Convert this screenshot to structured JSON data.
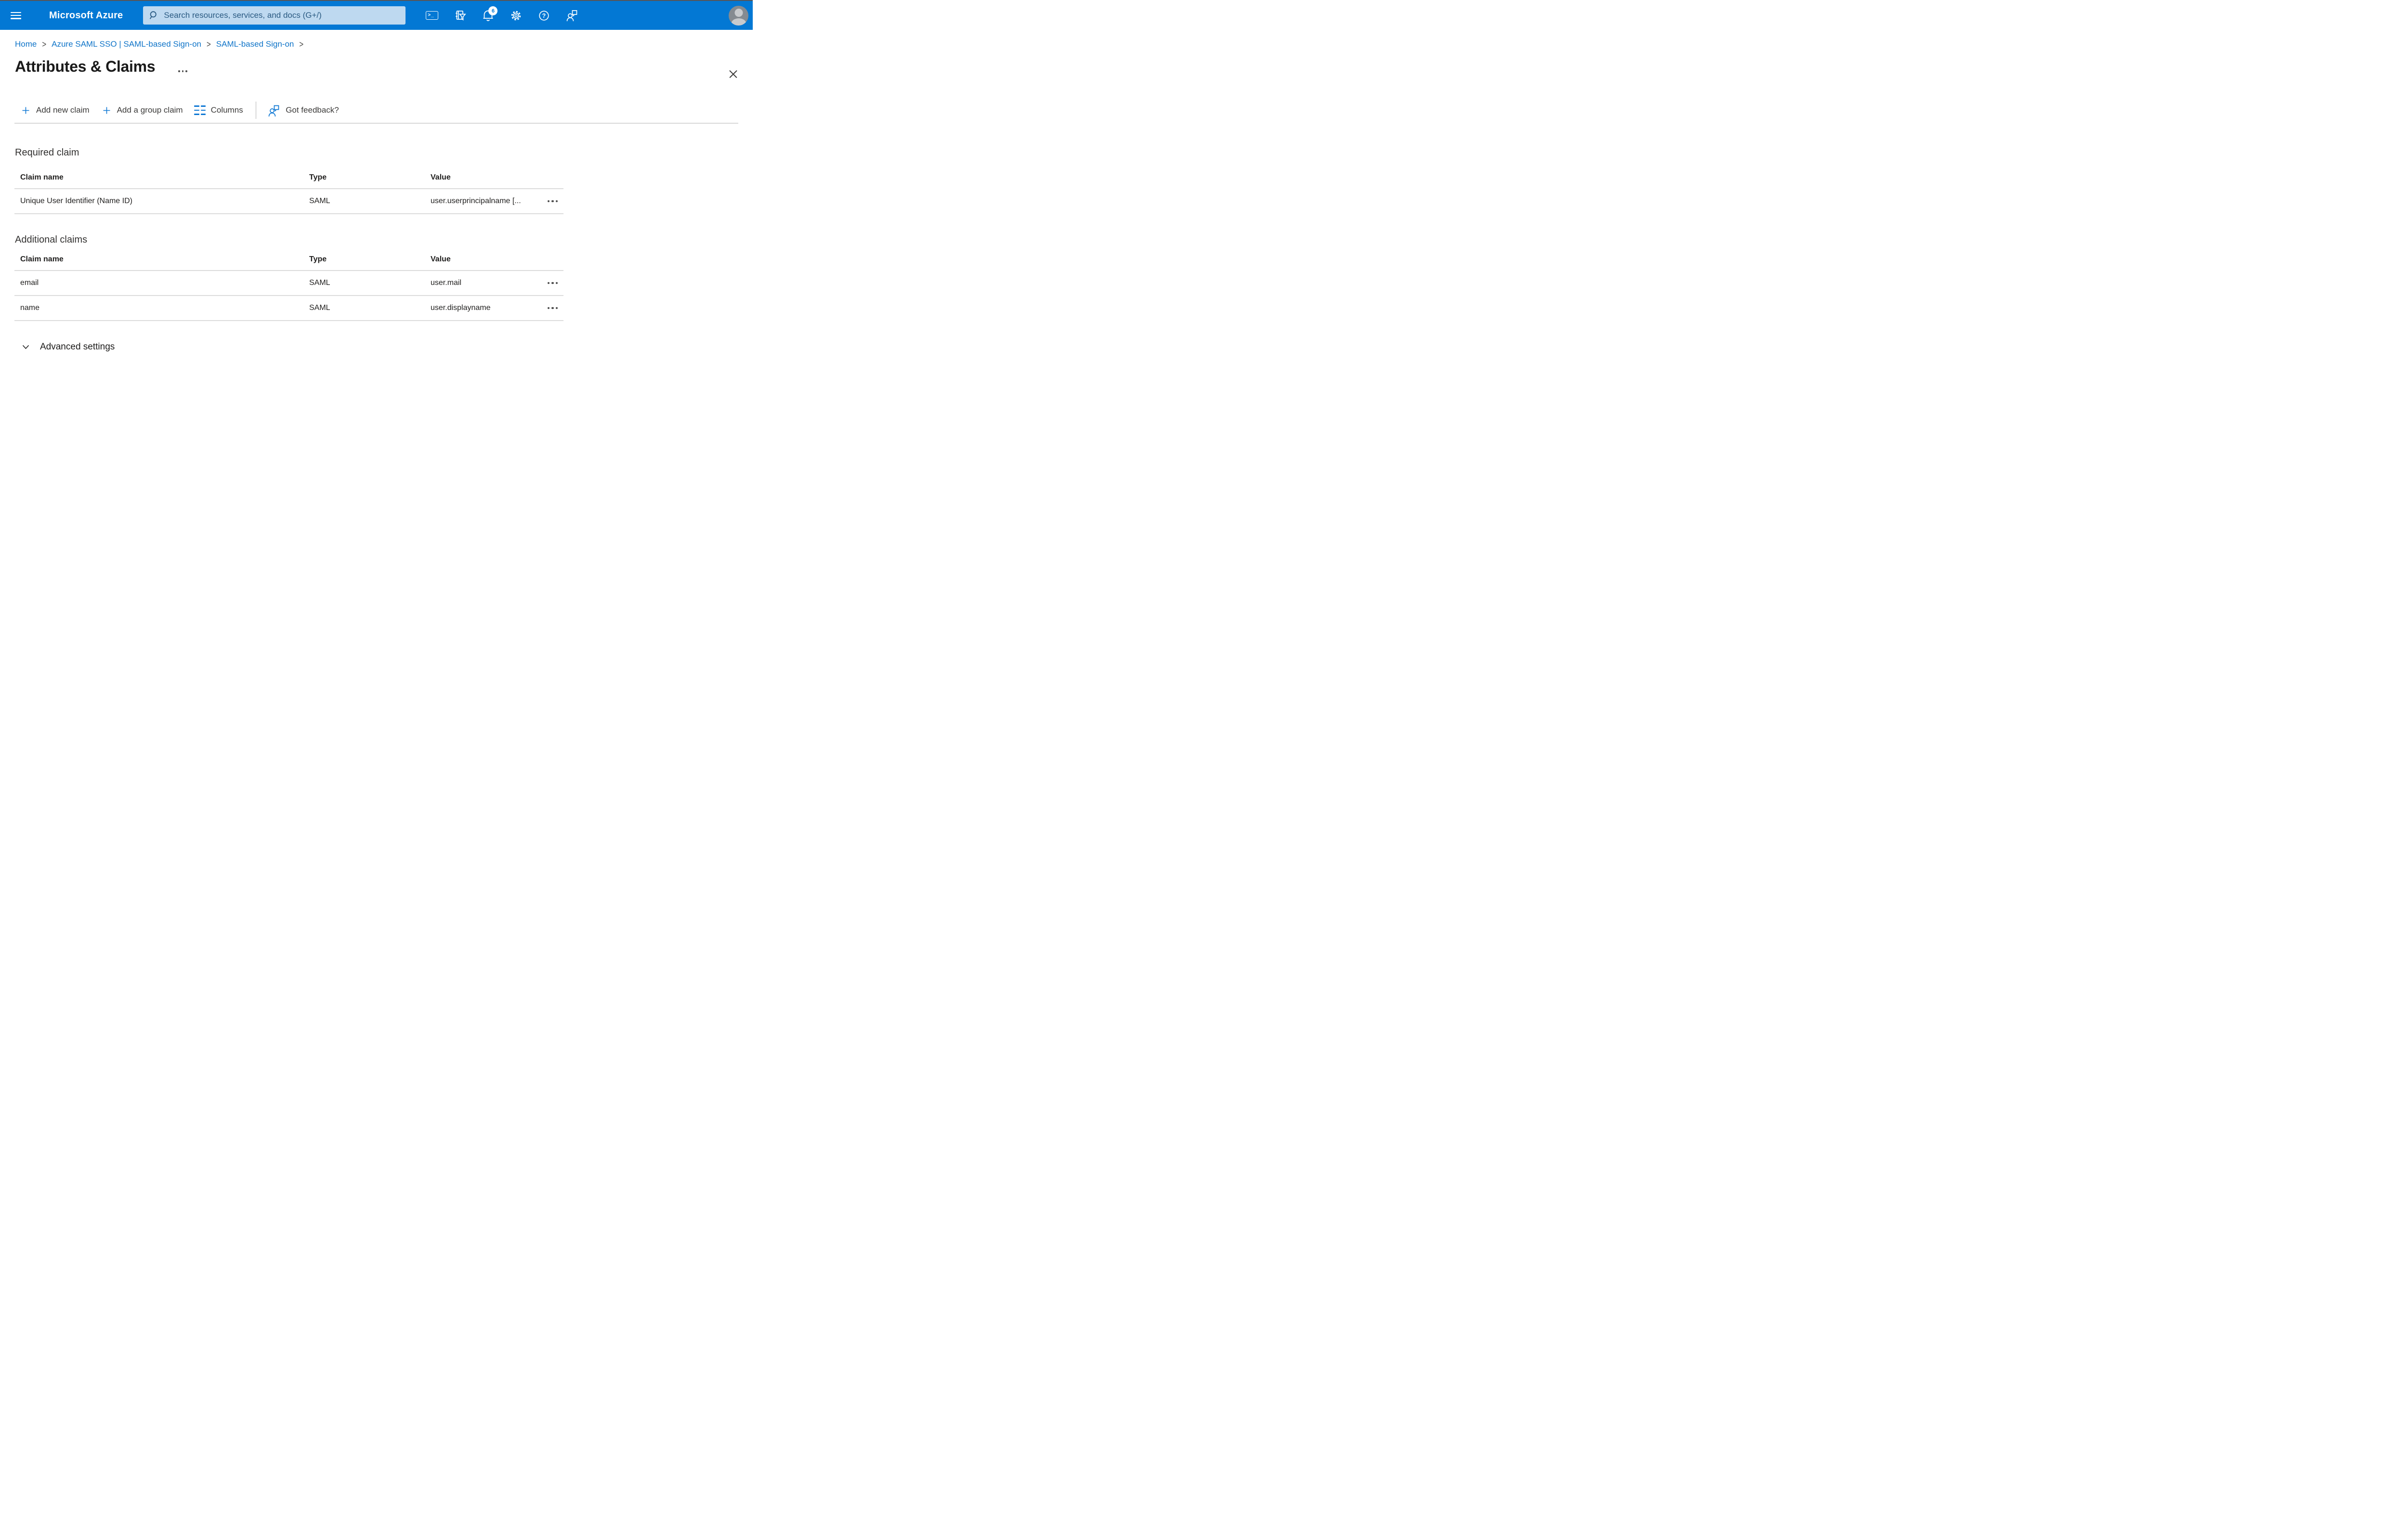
{
  "topbar": {
    "brand": "Microsoft Azure",
    "search_placeholder": "Search resources, services, and docs (G+/)",
    "cloudshell_glyph": ">_",
    "notification_count": "6"
  },
  "breadcrumb": {
    "separator": ">",
    "items": [
      {
        "label": "Home"
      },
      {
        "label": "Azure SAML SSO | SAML-based Sign-on"
      },
      {
        "label": "SAML-based Sign-on"
      }
    ]
  },
  "page": {
    "title": "Attributes & Claims"
  },
  "toolbar": {
    "items": [
      {
        "label": "Add new claim"
      },
      {
        "label": "Add a group claim"
      },
      {
        "label": "Columns"
      },
      {
        "label": "Got feedback?"
      }
    ]
  },
  "sections": {
    "required": {
      "heading": "Required claim",
      "columns": [
        "Claim name",
        "Type",
        "Value"
      ],
      "rows": [
        {
          "claim_name": "Unique User Identifier (Name ID)",
          "type": "SAML",
          "value": "user.userprincipalname [..."
        }
      ]
    },
    "additional": {
      "heading": "Additional claims",
      "columns": [
        "Claim name",
        "Type",
        "Value"
      ],
      "rows": [
        {
          "claim_name": "email",
          "type": "SAML",
          "value": "user.mail"
        },
        {
          "claim_name": "name",
          "type": "SAML",
          "value": "user.displayname"
        }
      ]
    }
  },
  "advanced": {
    "label": "Advanced settings"
  },
  "colors": {
    "topbar_blue": "#0378d4",
    "search_bg": "#bed9f0",
    "search_text": "#2a5a82",
    "link_blue": "#0f74c8",
    "accent_icon_blue": "#0f78d4",
    "divider_gray": "#dcdcdc",
    "text_dark": "#201f1e"
  }
}
